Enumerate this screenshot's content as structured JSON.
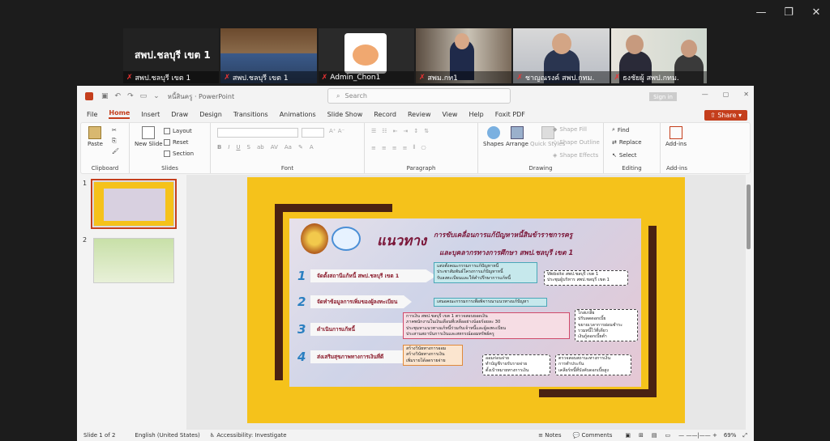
{
  "window": {
    "minimize": "—",
    "restore": "❐",
    "close": "✕"
  },
  "participants": [
    {
      "label": "สพป.ชลบุรี เขต 1",
      "big_name": "สพป.ชลบุรี เขต 1",
      "active": false
    },
    {
      "label": "สพป.ชลบุรี เขต 1",
      "active": true
    },
    {
      "label": "Admin_Chon1",
      "active": false
    },
    {
      "label": "สพม.กท1",
      "active": false
    },
    {
      "label": "ชาญณรงค์ สพป.กทม.",
      "active": false
    },
    {
      "label": "ธงชัยผู้ สพป.กทม.",
      "active": false
    }
  ],
  "ppt": {
    "doc_title": "หนี้สินครู  ·  PowerPoint",
    "search_placeholder": "Search",
    "sign_in": "Sign in",
    "share": "Share",
    "menu": [
      "File",
      "Home",
      "Insert",
      "Draw",
      "Design",
      "Transitions",
      "Animations",
      "Slide Show",
      "Record",
      "Review",
      "View",
      "Help",
      "Foxit PDF"
    ],
    "active_menu": "Home",
    "ribbon": {
      "paste": "Paste",
      "clipboard": "Clipboard",
      "new_slide": "New Slide",
      "layout": "Layout",
      "reset": "Reset",
      "section": "Section",
      "slides": "Slides",
      "font": "Font",
      "paragraph": "Paragraph",
      "shapes": "Shapes",
      "arrange": "Arrange",
      "quick_styles": "Quick Styles",
      "shape_fill": "Shape Fill",
      "shape_outline": "Shape Outline",
      "shape_effects": "Shape Effects",
      "drawing": "Drawing",
      "find": "Find",
      "replace": "Replace",
      "select": "Select",
      "editing": "Editing",
      "addins": "Add-ins",
      "addins_group": "Add-ins"
    },
    "thumbs": [
      "1",
      "2"
    ],
    "status": {
      "slide_of": "Slide 1 of 2",
      "language": "English (United States)",
      "accessibility": "Accessibility: Investigate",
      "notes": "Notes",
      "comments": "Comments",
      "zoom": "69%"
    }
  },
  "slide": {
    "head": "แนวทาง",
    "sub1": "การขับเคลื่อนการแก้ปัญหาหนี้สินข้าราชการครู",
    "sub2": "และบุคลากรทางการศึกษา สพป.ชลบุรี เขต 1",
    "steps": [
      {
        "num": "1",
        "label": "จัดตั้งสถานีแก้หนี้  สพป.ชลบุรี เขต 1"
      },
      {
        "num": "2",
        "label": "จัดทำข้อมูลการเพิ่มของผู้ลงทะเบียน"
      },
      {
        "num": "3",
        "label": "ดำเนินการแก้หนี้"
      },
      {
        "num": "4",
        "label": "ส่งเสริมสุขภาพทางการเงินที่ดี"
      }
    ],
    "box1": [
      "แต่งตั้งคณะกรรมการแก้ปัญหาหนี้",
      "ประชาสัมพันธ์โครงการแก้ปัญหาหนี้",
      "รับลงทะเบียนและให้คำปรึกษาการแก้หนี้"
    ],
    "box1_note": [
      "Website สพป.ชลบุรี เขต 1",
      "ประชุมผู้บริหาร สพป.ชลบุรี เขต 1"
    ],
    "box2": [
      "เสนอคณะกรรมการเพื่อพิจารณาแนวทางแก้ปัญหา"
    ],
    "box3": [
      "การเงิน สพป.ชลบุรี เขต 1 ตรวจสอบยอดเงิน",
      "ภาคพนักงานในเงินเดือนที่เหลืออย่างน้อยร้อยละ 30",
      "ประชุมหาแนวทางแก้หนี้ร่วมกับเจ้าหนี้และผู้ลงทะเบียน",
      "ประสานสถาบันการเงินและสหกรณ์ออมทรัพย์ครู"
    ],
    "box3_note": [
      "ไกล่เกลี่ย",
      "ปรับลดดอกเบี้ย",
      "ขยายเวลาการผ่อนชำระ",
      "รวมหนี้ไว้ที่เดียว",
      "เงินกู้ดอกเบี้ยต่ำ"
    ],
    "box4": [
      "สร้างวินัยทางการออม",
      "สร้างวินัยทางการเงิน",
      "เพิ่มรายได้ลดรายจ่าย"
    ],
    "box4_note": [
      "ออมก่อนจ่าย",
      "ทำบัญชีรายรับรายจ่าย",
      "ตั้งเป้าหมายทางการเงิน"
    ],
    "box4_note2": [
      "ตรวจสอบสถานะทางการเงิน",
      "การทำประกัน",
      "เคลียร์หนี้ที่บังคับดอกเบี้ยสูง"
    ]
  },
  "colors": {
    "accent": "#c43e1c",
    "slide_bg": "#f5c21b",
    "active_border": "#3ddc84"
  }
}
